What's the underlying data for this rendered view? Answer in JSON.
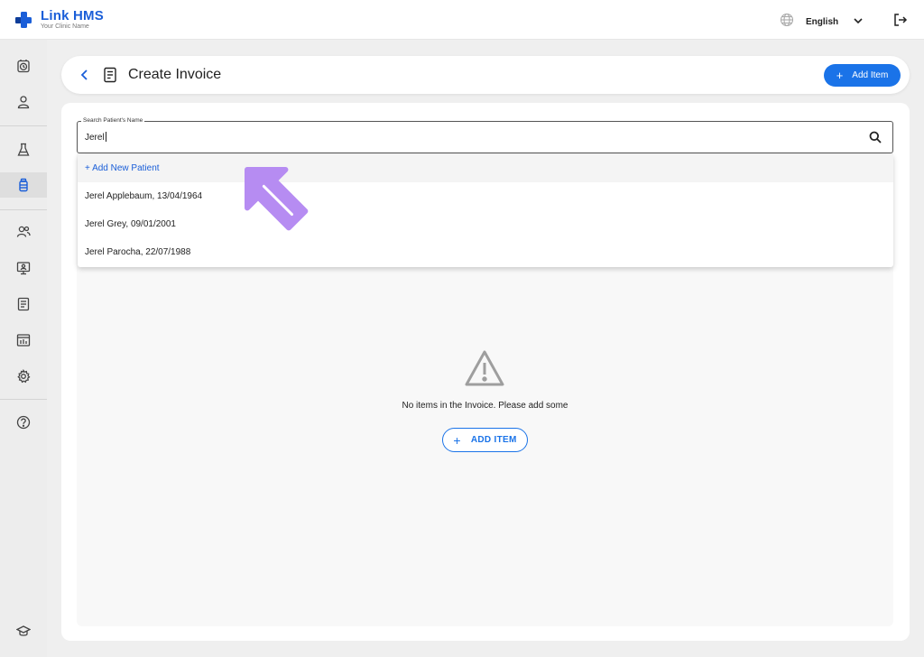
{
  "brand": {
    "name": "Link HMS",
    "tagline": "Your Clinic Name",
    "color": "#1a5ed8"
  },
  "header": {
    "language": "English",
    "icons": [
      "globe-icon",
      "chevron-down-icon",
      "logout-icon"
    ]
  },
  "sidebar": {
    "active_index": 3,
    "items": [
      "clock-icon",
      "user-icon",
      "flask-icon",
      "bottle-icon",
      "users-icon",
      "monitor-user-icon",
      "report-icon",
      "analytics-icon",
      "settings-icon",
      "help-icon",
      "graduation-cap-icon"
    ]
  },
  "page": {
    "title": "Create Invoice",
    "add_item_label": "Add Item"
  },
  "search": {
    "label": "Search Patient's Name",
    "value": "Jerel"
  },
  "dropdown": {
    "add_new": "+ Add New Patient",
    "results": [
      "Jerel Applebaum, 13/04/1964",
      "Jerel Grey, 09/01/2001",
      "Jerel Parocha, 22/07/1988"
    ]
  },
  "empty_state": {
    "message": "No items in the Invoice. Please add some",
    "button_label": "ADD ITEM"
  },
  "colors": {
    "accent": "#1a73e8",
    "annotation": "#b68cf2"
  }
}
